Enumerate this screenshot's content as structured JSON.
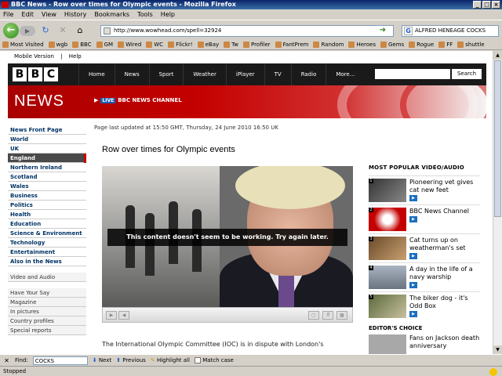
{
  "window": {
    "title": "BBC News - Row over times for Olympic events - Mozilla Firefox",
    "buttons": [
      "_",
      "□",
      "×"
    ]
  },
  "menu": [
    "File",
    "Edit",
    "View",
    "History",
    "Bookmarks",
    "Tools",
    "Help"
  ],
  "nav": {
    "url": "http://www.wowhead.com/spell=32924",
    "search_value": "ALFRED HENEAGE COCKS",
    "search_engine_letter": "G"
  },
  "bookmarks": [
    "Most Visited",
    "wgb",
    "BBC",
    "GM",
    "Wired",
    "WC",
    "Flickr!",
    "eBay",
    "Tw",
    "Profiler",
    "FantPrem",
    "Random",
    "Heroes",
    "Gems",
    "Rogue",
    "FF",
    "shuttle"
  ],
  "page": {
    "toplinks": [
      "Mobile Version",
      "|",
      "Help"
    ],
    "bbc_letters": [
      "B",
      "B",
      "C"
    ],
    "bbc_nav": [
      "Home",
      "News",
      "Sport",
      "Weather",
      "iPlayer",
      "TV",
      "Radio",
      "More..."
    ],
    "search_button": "Search",
    "news_word": "NEWS",
    "live_tag": "LIVE",
    "live_channel": "BBC NEWS CHANNEL",
    "left_nav": [
      "News Front Page",
      "World",
      "UK",
      "England",
      "Northern Ireland",
      "Scotland",
      "Wales",
      "Business",
      "Politics",
      "Health",
      "Education",
      "Science & Environment",
      "Technology",
      "Entertainment",
      "Also in the News"
    ],
    "left_nav_active": "England",
    "left_nav_secondary": [
      "Video and Audio"
    ],
    "left_nav_tertiary": [
      "Have Your Say",
      "Magazine",
      "In pictures",
      "Country profiles",
      "Special reports"
    ],
    "updated": "Page last updated at 15:50 GMT, Thursday, 24 June 2010 16:50 UK",
    "headline": "Row over times for Olympic events",
    "player_message": "This content doesn't seem to be working. Try again later.",
    "body_text": "The International Olympic Committee (IOC) is in dispute with London's",
    "most_popular_title": "MOST POPULAR VIDEO/AUDIO",
    "most_popular": [
      {
        "num": "1",
        "title": "Pioneering vet gives cat new feet"
      },
      {
        "num": "2",
        "title": "BBC News Channel"
      },
      {
        "num": "3",
        "title": "Cat turns up on weatherman's set"
      },
      {
        "num": "4",
        "title": "A day in the life of a navy warship"
      },
      {
        "num": "5",
        "title": "The biker dog - it's Odd Box"
      }
    ],
    "editors_choice_title": "EDITOR'S CHOICE",
    "editors_choice": [
      {
        "title": "Fans on Jackson death anniversary"
      }
    ]
  },
  "findbar": {
    "label": "Find:",
    "value": "COCKS",
    "next": "Next",
    "previous": "Previous",
    "highlight": "Highlight all",
    "match_case": "Match case"
  },
  "status": "Stopped",
  "colors": {
    "bbc_red": "#c40000",
    "bbc_black": "#1a1a1a",
    "link_blue": "#003366"
  }
}
